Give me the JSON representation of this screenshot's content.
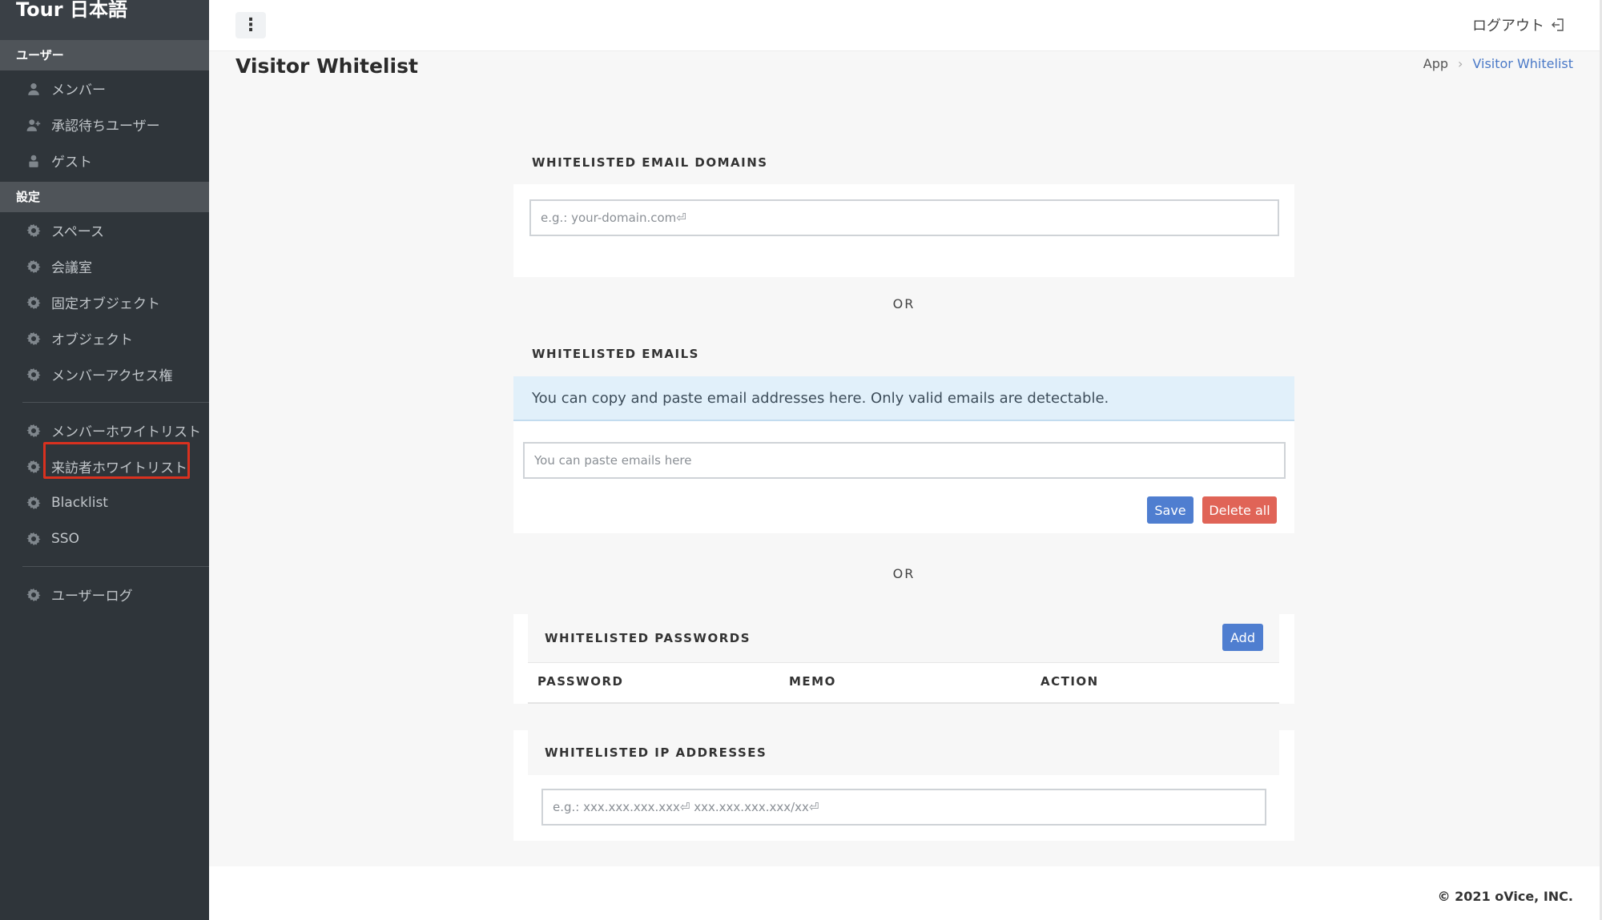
{
  "sidebar": {
    "brand": "Tour 日本語",
    "sections": [
      {
        "title": "ユーザー",
        "items": [
          {
            "label": "メンバー",
            "icon": "user-icon"
          },
          {
            "label": "承認待ちユーザー",
            "icon": "user-plus-icon"
          },
          {
            "label": "ゲスト",
            "icon": "guest-icon"
          }
        ]
      },
      {
        "title": "設定",
        "items": [
          {
            "label": "スペース",
            "icon": "gear-icon"
          },
          {
            "label": "会議室",
            "icon": "gear-icon"
          },
          {
            "label": "固定オブジェクト",
            "icon": "gear-icon"
          },
          {
            "label": "オブジェクト",
            "icon": "gear-icon"
          },
          {
            "label": "メンバーアクセス権",
            "icon": "gear-icon"
          },
          {
            "label": "メンバーホワイトリスト",
            "icon": "gear-icon"
          },
          {
            "label": "来訪者ホワイトリスト",
            "icon": "gear-icon"
          },
          {
            "label": "Blacklist",
            "icon": "gear-icon"
          },
          {
            "label": "SSO",
            "icon": "gear-icon"
          },
          {
            "label": "ユーザーログ",
            "icon": "gear-icon"
          }
        ]
      }
    ]
  },
  "header": {
    "logout_label": "ログアウト"
  },
  "page": {
    "title": "Visitor Whitelist",
    "breadcrumb": [
      "App",
      "Visitor Whitelist"
    ]
  },
  "email_domains": {
    "header": "WHITELISTED EMAIL DOMAINS",
    "placeholder": "e.g.: your-domain.com⏎"
  },
  "or_label": "OR",
  "emails": {
    "header": "WHITELISTED EMAILS",
    "info": "You can copy and paste email addresses here. Only valid emails are detectable.",
    "placeholder": "You can paste emails here",
    "save_label": "Save",
    "delete_label": "Delete all"
  },
  "passwords": {
    "header": "WHITELISTED PASSWORDS",
    "add_label": "Add",
    "columns": [
      "PASSWORD",
      "MEMO",
      "ACTION"
    ]
  },
  "ip_addresses": {
    "header": "WHITELISTED IP ADDRESSES",
    "placeholder": "e.g.: xxx.xxx.xxx.xxx⏎ xxx.xxx.xxx.xxx/xx⏎"
  },
  "footer": {
    "copyright": "© 2021 oVice, INC."
  },
  "colors": {
    "sidebar_bg": "#2f353a",
    "accent_blue": "#4f7ed0",
    "danger_red": "#e06457",
    "highlight_red": "#d9311f",
    "info_bg": "#e1f0fa"
  }
}
